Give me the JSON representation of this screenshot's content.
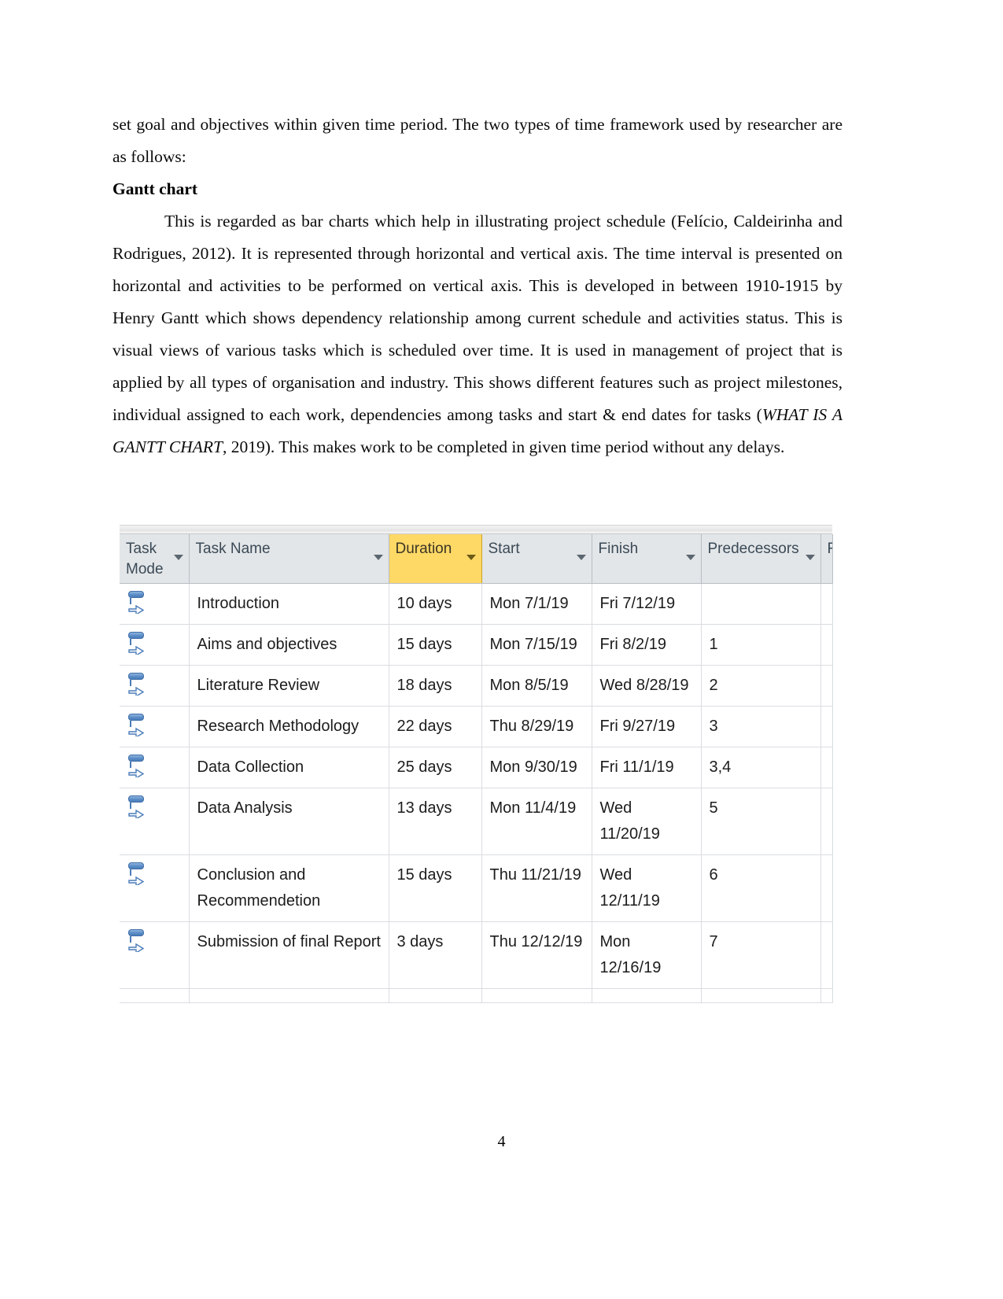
{
  "document": {
    "page_number": "4",
    "paragraphs": [
      {
        "id": "p1",
        "text": "set goal and objectives within given time period. The two types of time framework used by researcher are as follows:"
      }
    ],
    "heading": "Gantt chart",
    "paragraph2": {
      "part1": "This is regarded as bar charts which help in illustrating project schedule (Felício, Caldeirinha and Rodrigues, 2012). It is represented through horizontal and vertical axis. The time interval is presented on horizontal and activities to be performed on vertical axis. This is developed in between 1910-1915 by Henry Gantt which shows dependency relationship among current schedule and activities status.  This is visual views of various tasks which is scheduled over time. It is used in management of project that is applied by all types of organisation and industry. This shows different features such as project milestones, individual assigned to each work, dependencies among tasks and start & end dates for tasks (",
      "italic": "WHAT IS A GANTT CHART",
      "part2": ", 2019).  This makes work to be completed in given time period without any delays."
    }
  },
  "gantt_table": {
    "accent_highlight_color": "#ffd966",
    "header_background": "#e3e6e8",
    "columns": [
      {
        "key": "task_mode",
        "label": "Task\nMode",
        "highlighted": false,
        "has_filter": true
      },
      {
        "key": "task_name",
        "label": "Task Name",
        "highlighted": false,
        "has_filter": true
      },
      {
        "key": "duration",
        "label": "Duration",
        "highlighted": true,
        "has_filter": true
      },
      {
        "key": "start",
        "label": "Start",
        "highlighted": false,
        "has_filter": true
      },
      {
        "key": "finish",
        "label": "Finish",
        "highlighted": false,
        "has_filter": true
      },
      {
        "key": "predecessors",
        "label": "Predecessors",
        "highlighted": false,
        "has_filter": true
      },
      {
        "key": "resource",
        "label": "R",
        "highlighted": false,
        "has_filter": false
      }
    ],
    "rows": [
      {
        "mode_icon": "manually-scheduled-icon",
        "task_name": "Introduction",
        "duration": "10 days",
        "start": "Mon 7/1/19",
        "finish": "Fri 7/12/19",
        "predecessors": "",
        "resource": ""
      },
      {
        "mode_icon": "manually-scheduled-icon",
        "task_name": "Aims and objectives",
        "duration": "15 days",
        "start": "Mon 7/15/19",
        "finish": "Fri 8/2/19",
        "predecessors": "1",
        "resource": ""
      },
      {
        "mode_icon": "manually-scheduled-icon",
        "task_name": "Literature Review",
        "duration": "18 days",
        "start": "Mon 8/5/19",
        "finish": "Wed 8/28/19",
        "predecessors": "2",
        "resource": ""
      },
      {
        "mode_icon": "manually-scheduled-icon",
        "task_name": "Research Methodology",
        "duration": "22 days",
        "start": "Thu 8/29/19",
        "finish": "Fri 9/27/19",
        "predecessors": "3",
        "resource": ""
      },
      {
        "mode_icon": "manually-scheduled-icon",
        "task_name": "Data Collection",
        "duration": "25 days",
        "start": "Mon 9/30/19",
        "finish": "Fri 11/1/19",
        "predecessors": "3,4",
        "resource": ""
      },
      {
        "mode_icon": "manually-scheduled-icon",
        "task_name": "Data Analysis",
        "duration": "13 days",
        "start": "Mon 11/4/19",
        "finish": "Wed 11/20/19",
        "predecessors": "5",
        "resource": ""
      },
      {
        "mode_icon": "manually-scheduled-icon",
        "task_name": "Conclusion and Recommendetion",
        "duration": "15 days",
        "start": "Thu 11/21/19",
        "finish": "Wed 12/11/19",
        "predecessors": "6",
        "resource": ""
      },
      {
        "mode_icon": "manually-scheduled-icon",
        "task_name": "Submission of final Report",
        "duration": "3 days",
        "start": "Thu 12/12/19",
        "finish": "Mon 12/16/19",
        "predecessors": "7",
        "resource": ""
      }
    ]
  }
}
